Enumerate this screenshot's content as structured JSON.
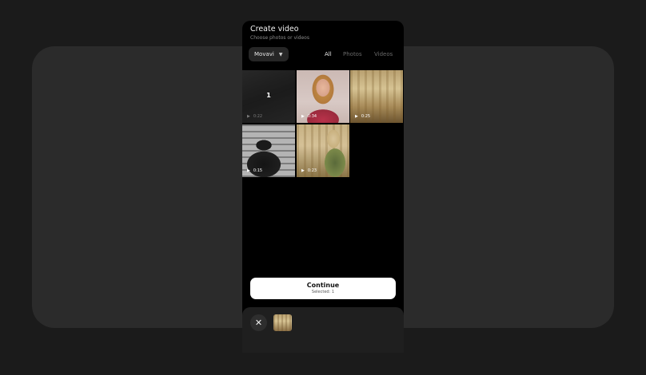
{
  "header": {
    "title": "Create video",
    "subtitle": "Choose photos or videos"
  },
  "album": {
    "label": "Movavi",
    "icon": "chevron-down-icon"
  },
  "filters": {
    "all": "All",
    "photos": "Photos",
    "videos": "Videos",
    "active": "All"
  },
  "grid": {
    "items": [
      {
        "duration": "0:22",
        "selected_index": "1",
        "selected": true
      },
      {
        "duration": "0:34",
        "selected": false
      },
      {
        "duration": "0:25",
        "selected": false
      },
      {
        "duration": "0:15",
        "selected": false
      },
      {
        "duration": "0:23",
        "selected": false
      }
    ]
  },
  "continue": {
    "label": "Continue",
    "selected_text": "Selected: 1"
  },
  "tray": {
    "close_icon": "close-icon",
    "selected_count": 1
  },
  "colors": {
    "background": "#1b1b1b",
    "panel": "#2b2b2b",
    "screen": "#000000",
    "button": "#ffffff",
    "tray": "#1f1f1f"
  }
}
